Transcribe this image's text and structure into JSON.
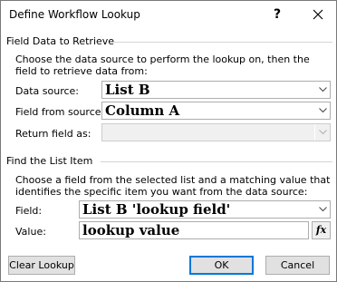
{
  "window": {
    "title": "Define Workflow Lookup",
    "help_label": "?"
  },
  "field_data": {
    "group_label": "Field Data to Retrieve",
    "description": "Choose the data source to perform the lookup on, then the field to retrieve data from:",
    "data_source_label": "Data source:",
    "data_source_value": "List B",
    "field_from_source_label": "Field from source:",
    "field_from_source_value": "Column A",
    "return_field_label": "Return field as:",
    "return_field_value": ""
  },
  "find_item": {
    "group_label": "Find the List Item",
    "description": "Choose a field from the selected list and a matching value that identifies the specific item you want from the data source:",
    "field_label": "Field:",
    "field_value": "List B 'lookup field'",
    "value_label": "Value:",
    "value_value": "lookup value",
    "fx_label": "fx"
  },
  "buttons": {
    "clear_lookup": "Clear Lookup",
    "ok": "OK",
    "cancel": "Cancel"
  }
}
